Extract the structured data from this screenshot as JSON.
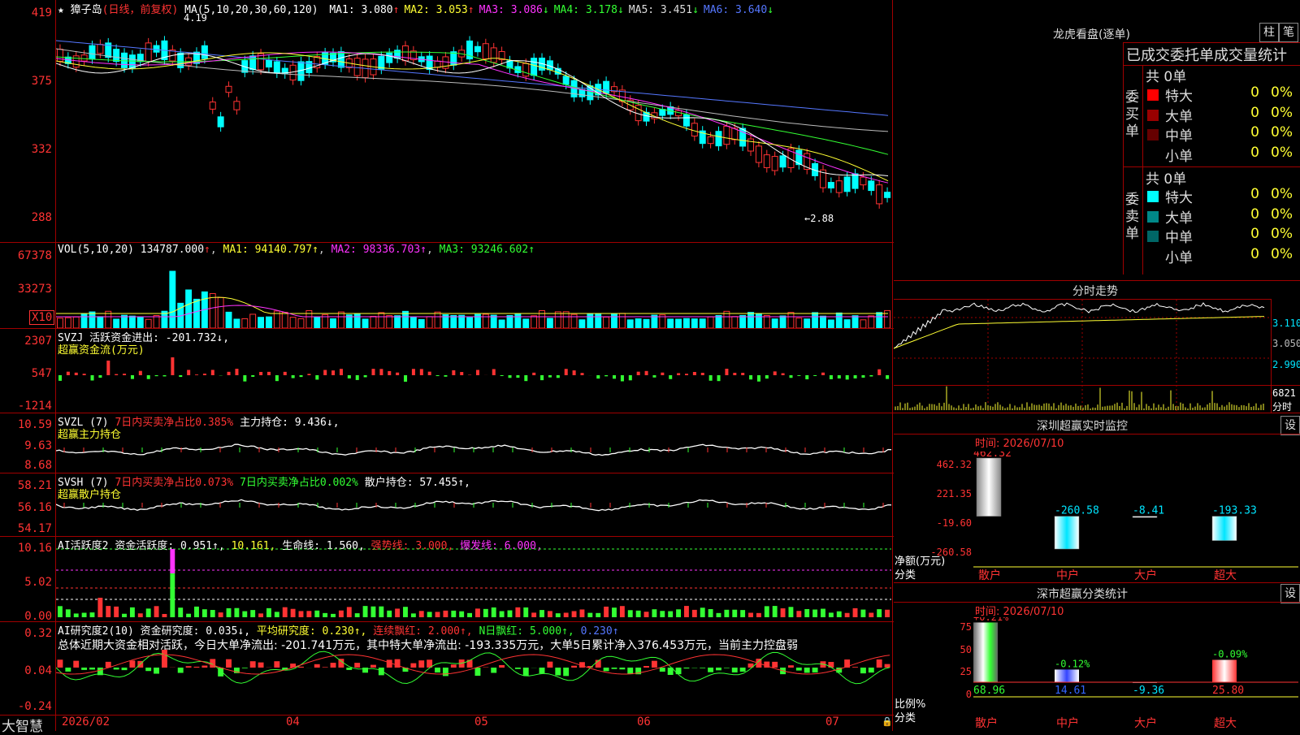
{
  "app_name": "大智慧",
  "main": {
    "stock_name": "獐子岛",
    "period": "(日线，前复权)",
    "ma_label": "MA(5,10,20,30,60,120)",
    "ma": [
      {
        "name": "MA1:",
        "value": "3.080",
        "arrow": "↑",
        "color": "#ffffff"
      },
      {
        "name": "MA2:",
        "value": "3.053",
        "arrow": "↑",
        "color": "#ffff33"
      },
      {
        "name": "MA3:",
        "value": "3.086",
        "arrow": "↓",
        "color": "#ff33ff"
      },
      {
        "name": "MA4:",
        "value": "3.178",
        "arrow": "↓",
        "color": "#33ff33"
      },
      {
        "name": "MA5:",
        "value": "3.451",
        "arrow": "↓",
        "color": "#dddddd"
      },
      {
        "name": "MA6:",
        "value": "3.640",
        "arrow": "↓",
        "color": "#5577ff"
      }
    ],
    "high_mark": "4.19",
    "low_mark": "←2.88",
    "y_labels": [
      "419",
      "375",
      "332",
      "288"
    ]
  },
  "volume": {
    "label": "VOL(5,10,20)",
    "value": "134787.000",
    "ma1": "MA1: 94140.797↑",
    "ma2": "MA2: 98336.703↑",
    "ma3": "MA3: 93246.602↑",
    "y_labels": [
      "67378",
      "33273"
    ],
    "unit": "X10"
  },
  "svzj": {
    "label": "SVZJ",
    "text": "活跃资金进出: -201.732↓,",
    "sub": "超赢资金流(万元)",
    "y_labels": [
      "2307",
      "547",
      "-1214"
    ]
  },
  "svzl": {
    "label": "SVZL (7)",
    "red_text": "7日内买卖净占比0.385%",
    "text": "主力持仓: 9.436↓,",
    "sub": "超赢主力持仓",
    "y_labels": [
      "10.59",
      "9.63",
      "8.68"
    ]
  },
  "svsh": {
    "label": "SVSH (7)",
    "red_text": "7日内买卖净占比0.073%",
    "green_text": "7日内买卖净占比0.002%",
    "text": "散户持仓: 57.455↑,",
    "sub": "超赢散户持仓",
    "y_labels": [
      "58.21",
      "56.16",
      "54.17"
    ]
  },
  "ai1": {
    "label": "AI活跃度2",
    "text": "资金活跃度: 0.951↑,",
    "v2": "10.161,",
    "v3": "生命线: 1.560,",
    "v4": "强势线: 3.000,",
    "v5": "爆发线: 6.000,",
    "y_labels": [
      "10.16",
      "5.02",
      "0.00"
    ]
  },
  "ai2": {
    "label": "AI研究度2(10)",
    "text": "资金研究度: 0.035↓,",
    "v2": "平均研究度: 0.230↑,",
    "v3": "连续飘红: 2.000↑,",
    "v4": "N日飘红: 5.000↑,",
    "v5": "0.230↑",
    "summary": "总体近期大资金相对活跃，今日大单净流出: -201.741万元，其中特大单净流出: -193.335万元，大单5日累计净入376.453万元，当前主力控盘弱",
    "y_labels": [
      "0.32",
      "0.04",
      "-0.24"
    ]
  },
  "x_axis": [
    "2026/02",
    "04",
    "05",
    "06",
    "07"
  ],
  "lhb": {
    "title": "龙虎看盘(逐单)",
    "btn1": "柱",
    "btn2": "笔",
    "header": "已成交委托单成交量统计",
    "buy_label": "委买单",
    "sell_label": "委卖单",
    "buy_total": "共 0单",
    "sell_total": "共 0单",
    "buy_rows": [
      {
        "name": "特大",
        "count": "0",
        "pct": "0%",
        "color": "#ff0000"
      },
      {
        "name": "大单",
        "count": "0",
        "pct": "0%",
        "color": "#990000"
      },
      {
        "name": "中单",
        "count": "0",
        "pct": "0%",
        "color": "#660000"
      },
      {
        "name": "小单",
        "count": "0",
        "pct": "0%",
        "color": ""
      }
    ],
    "sell_rows": [
      {
        "name": "特大",
        "count": "0",
        "pct": "0%",
        "color": "#00ffff"
      },
      {
        "name": "大单",
        "count": "0",
        "pct": "0%",
        "color": "#008888"
      },
      {
        "name": "中单",
        "count": "0",
        "pct": "0%",
        "color": "#006666"
      },
      {
        "name": "小单",
        "count": "0",
        "pct": "0%",
        "color": ""
      }
    ]
  },
  "intraday": {
    "title": "分时走势",
    "y_labels": [
      "3.110",
      "3.050",
      "2.990"
    ],
    "vol_label": "6821",
    "vol_unit": "分时"
  },
  "sz_monitor": {
    "title": "深圳超赢实时监控",
    "btn": "设",
    "time": "时间: 2026/07/10",
    "y_labels": [
      "462.32",
      "221.35",
      "-19.60",
      "-260.58"
    ],
    "bar_values": [
      "462.32",
      "-260.58",
      "-8.41",
      "-193.33"
    ],
    "categories": [
      "散户",
      "中户",
      "大户",
      "超大"
    ],
    "unit_label": "净额(万元)",
    "cat_label": "分类"
  },
  "sz_stats": {
    "title": "深市超赢分类统计",
    "btn": "设",
    "time": "时间: 2026/07/10",
    "y_labels": [
      "75",
      "50",
      "25",
      "0"
    ],
    "top_labels": [
      "+0.21%",
      "-0.12%",
      "-0.09%"
    ],
    "values": [
      "68.96",
      "14.61",
      "-9.36",
      "25.80"
    ],
    "categories": [
      "散户",
      "中户",
      "大户",
      "超大"
    ],
    "unit_label": "比例%",
    "cat_label": "分类"
  },
  "chart_data": [
    {
      "type": "bar",
      "title": "深圳超赢实时监控",
      "categories": [
        "散户",
        "中户",
        "大户",
        "超大"
      ],
      "values": [
        462.32,
        -260.58,
        -8.41,
        -193.33
      ],
      "ylabel": "净额(万元)",
      "ylim": [
        -260.58,
        462.32
      ]
    },
    {
      "type": "bar",
      "title": "深市超赢分类统计",
      "categories": [
        "散户",
        "中户",
        "大户",
        "超大"
      ],
      "values": [
        68.96,
        14.61,
        -9.36,
        25.8
      ],
      "ylabel": "比例%",
      "ylim": [
        0,
        75
      ]
    }
  ]
}
